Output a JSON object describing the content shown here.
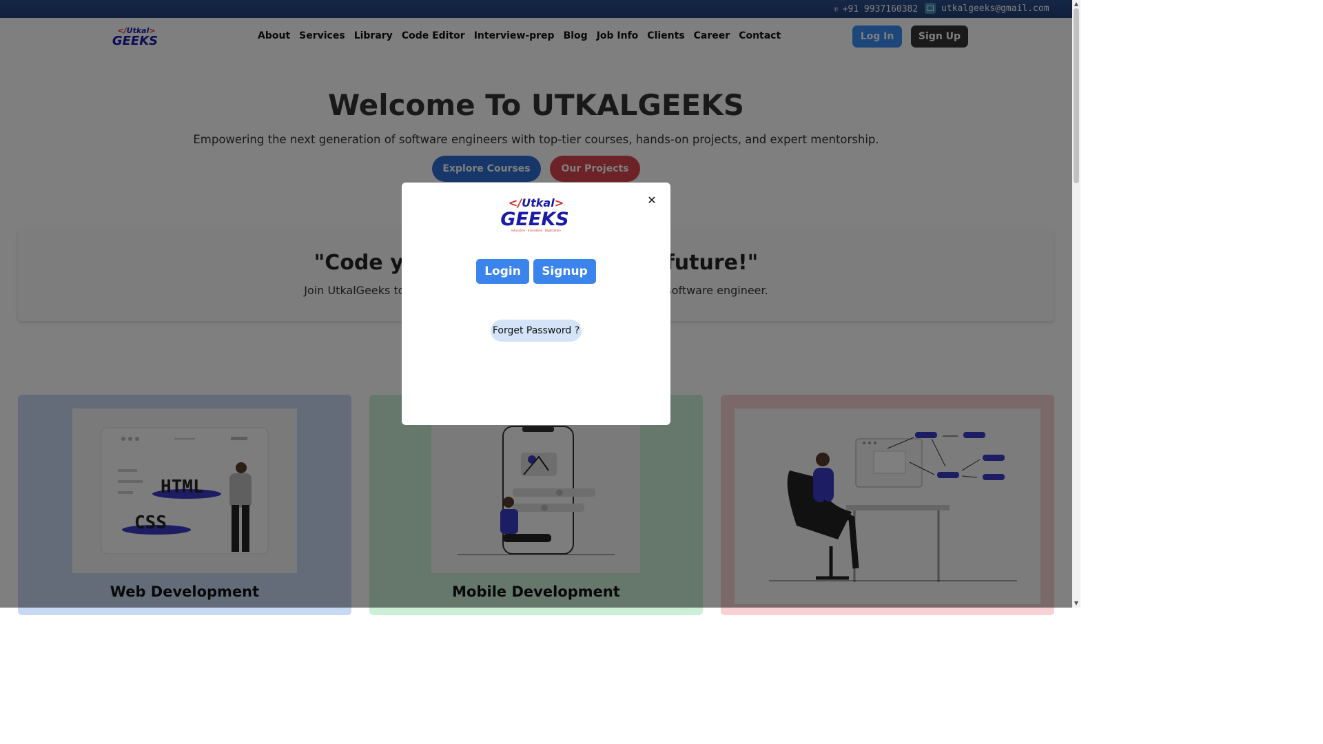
{
  "topbar": {
    "phone_icon": "phone-icon",
    "phone": "+91 9937160382",
    "email_icon": "mail-icon",
    "email": "utkalgeeks@gmail.com"
  },
  "brand": {
    "logo_top": "</Utkal>",
    "logo_bottom": "GEEKS",
    "tagline": "Education · Innovation · Digitization"
  },
  "nav": {
    "items": [
      "About",
      "Services",
      "Library",
      "Code Editor",
      "Interview-prep",
      "Blog",
      "Job Info",
      "Clients",
      "Career",
      "Contact"
    ],
    "login_label": "Log In",
    "signup_label": "Sign Up"
  },
  "hero": {
    "title": "Welcome To UTKALGEEKS",
    "subtitle": "Empowering the next generation of software engineers with top-tier courses, hands-on projects, and expert mentorship.",
    "explore_label": "Explore Courses",
    "projects_label": "Our Projects"
  },
  "quote": {
    "left_text": "\"Code y",
    "right_text": "future!\"",
    "sub_left": "Join UtkalGeeks toc",
    "sub_right": "software engineer."
  },
  "cards": [
    {
      "title": "Web Development",
      "badge1": "HTML",
      "badge2": "CSS"
    },
    {
      "title": "Mobile Development"
    },
    {
      "title": ""
    }
  ],
  "modal": {
    "close_icon": "close-icon",
    "login_label": "Login",
    "signup_label": "Signup",
    "forget_label": "Forget Password ?"
  },
  "colors": {
    "topbar": "#1f3f78",
    "primary": "#3a8ef6",
    "dark": "#353535",
    "projects": "#d9454d",
    "card_web": "#c8d9f4",
    "card_mobile": "#cdeed7",
    "card_data": "#f7d2d5"
  }
}
